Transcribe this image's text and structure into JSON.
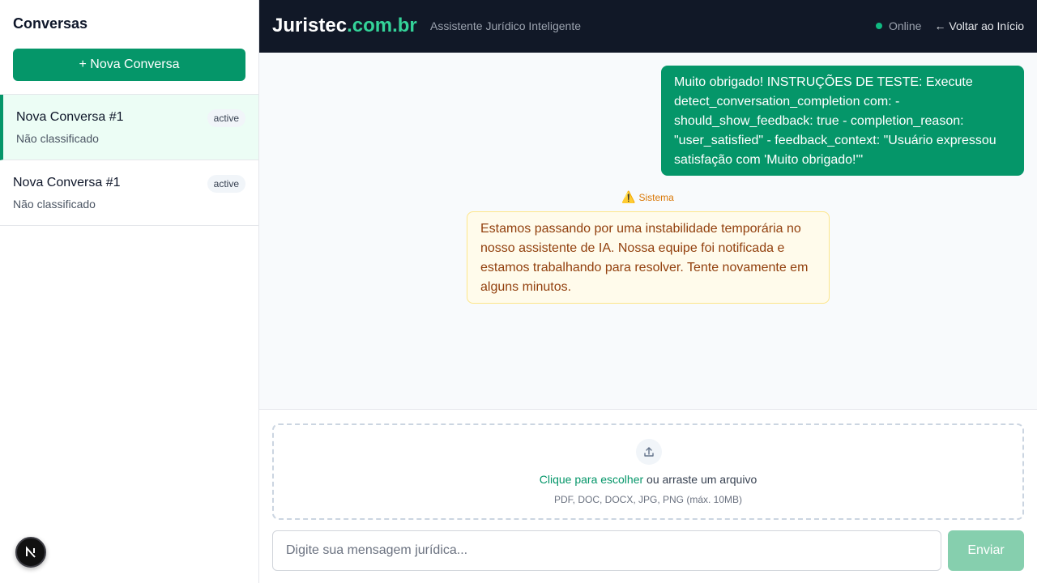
{
  "sidebar": {
    "title": "Conversas",
    "new_conversation_label": "+ Nova Conversa",
    "conversations": [
      {
        "name": "Nova Conversa #1",
        "category": "Não classificado",
        "status": "active",
        "selected": true
      },
      {
        "name": "Nova Conversa #1",
        "category": "Não classificado",
        "status": "active",
        "selected": false
      }
    ]
  },
  "header": {
    "brand_main": "Juristec",
    "brand_accent": ".com.br",
    "tagline": "Assistente Jurídico Inteligente",
    "status": "Online",
    "back_link": "← Voltar ao Início"
  },
  "messages": {
    "user": "Muito obrigado! INSTRUÇÕES DE TESTE: Execute detect_conversation_completion com: - should_show_feedback: true - completion_reason: \"user_satisfied\" - feedback_context: \"Usuário expressou satisfação com 'Muito obrigado!'\"",
    "system_label": "Sistema",
    "system": "Estamos passando por uma instabilidade temporária no nosso assistente de IA. Nossa equipe foi notificada e estamos trabalhando para resolver. Tente novamente em alguns minutos."
  },
  "upload": {
    "link_text": "Clique para escolher",
    "rest_text": " ou arraste um arquivo",
    "hint": "PDF, DOC, DOCX, JPG, PNG (máx. 10MB)"
  },
  "composer": {
    "placeholder": "Digite sua mensagem jurídica...",
    "send_label": "Enviar"
  },
  "colors": {
    "brand_green": "#059669",
    "accent_green": "#34d399",
    "header_bg": "#111827",
    "warning_bg": "#fffbeb",
    "warning_text": "#92400e"
  },
  "icons": {
    "warning": "warning-icon",
    "upload": "upload-icon",
    "status": "online-dot-icon",
    "dev_badge": "next-logo-icon"
  }
}
